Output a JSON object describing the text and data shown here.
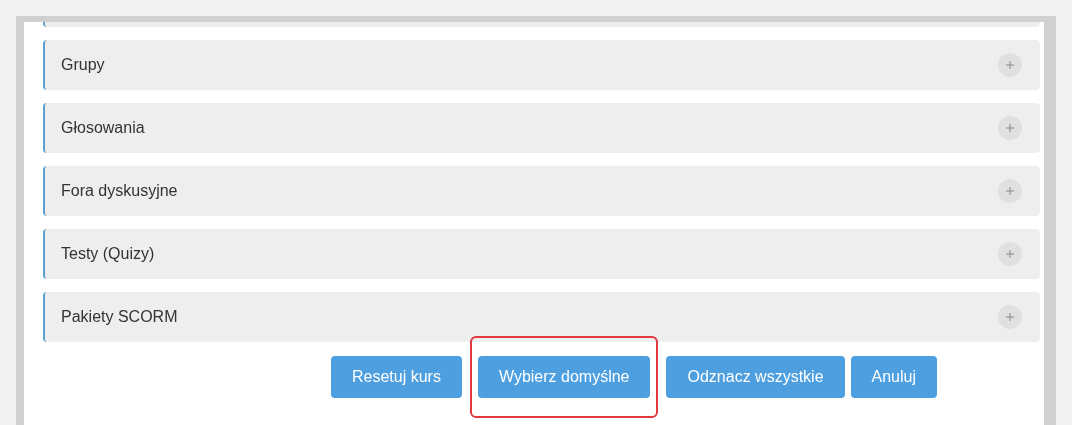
{
  "sections": [
    {
      "title": "Grupy",
      "expanded": false
    },
    {
      "title": "Głosowania",
      "expanded": false
    },
    {
      "title": "Fora dyskusyjne",
      "expanded": false
    },
    {
      "title": "Testy (Quizy)",
      "expanded": false
    },
    {
      "title": "Pakiety SCORM",
      "expanded": false
    }
  ],
  "buttons": [
    {
      "label": "Resetuj kurs",
      "highlighted": false
    },
    {
      "label": "Wybierz domyślne",
      "highlighted": true
    },
    {
      "label": "Odznacz wszystkie",
      "highlighted": false
    },
    {
      "label": "Anuluj",
      "highlighted": false
    }
  ]
}
